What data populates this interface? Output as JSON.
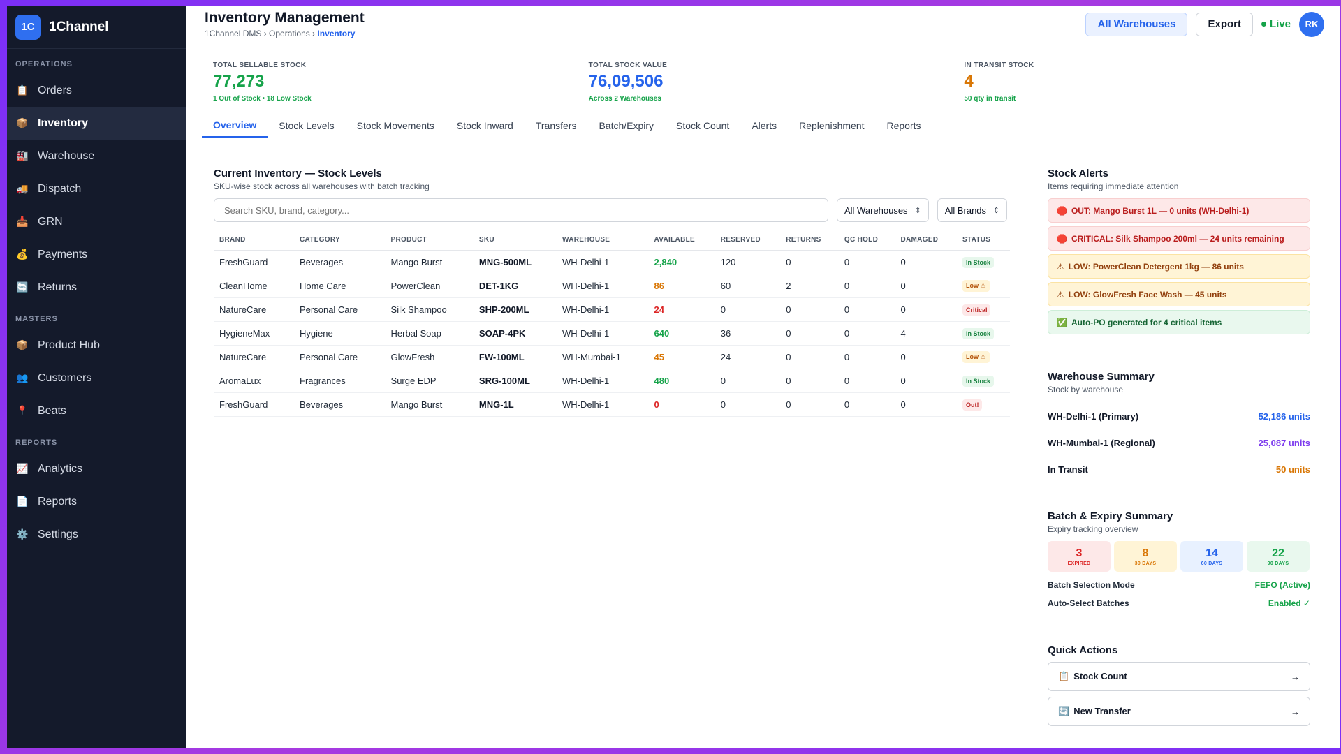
{
  "brand": {
    "logo": "1C",
    "name": "1Channel"
  },
  "sidebar": {
    "sections": [
      {
        "title": "OPERATIONS",
        "items": [
          {
            "label": "Orders",
            "icon": "📋"
          },
          {
            "label": "Inventory",
            "icon": "📦",
            "active": true
          },
          {
            "label": "Warehouse",
            "icon": "🏭"
          },
          {
            "label": "Dispatch",
            "icon": "🚚"
          },
          {
            "label": "GRN",
            "icon": "📥"
          },
          {
            "label": "Payments",
            "icon": "💰"
          },
          {
            "label": "Returns",
            "icon": "🔄"
          }
        ]
      },
      {
        "title": "MASTERS",
        "items": [
          {
            "label": "Product Hub",
            "icon": "📦"
          },
          {
            "label": "Customers",
            "icon": "👥"
          },
          {
            "label": "Beats",
            "icon": "📍"
          }
        ]
      },
      {
        "title": "REPORTS",
        "items": [
          {
            "label": "Analytics",
            "icon": "📈"
          },
          {
            "label": "Reports",
            "icon": "📄"
          },
          {
            "label": "Settings",
            "icon": "⚙️"
          }
        ]
      }
    ]
  },
  "header": {
    "title": "Inventory Management",
    "breadcrumb": [
      "1Channel DMS",
      "Operations",
      "Inventory"
    ],
    "buttons": {
      "warehouses": "All Warehouses",
      "export": "Export"
    },
    "live": "Live",
    "avatar": "RK"
  },
  "kpis": [
    {
      "label": "TOTAL SELLABLE STOCK",
      "value": "77,273",
      "sub": "1 Out of Stock • 18 Low Stock",
      "color": "#16a34a"
    },
    {
      "label": "TOTAL STOCK VALUE",
      "value": "76,09,506",
      "sub": "Across 2 Warehouses",
      "color": "#2563eb"
    },
    {
      "label": "IN TRANSIT STOCK",
      "value": "4",
      "sub": "50 qty in transit",
      "color": "#d97706"
    }
  ],
  "tabs": [
    "Overview",
    "Stock Levels",
    "Stock Movements",
    "Stock Inward",
    "Transfers",
    "Batch/Expiry",
    "Stock Count",
    "Alerts",
    "Replenishment",
    "Reports"
  ],
  "inventory": {
    "title": "Current Inventory — Stock Levels",
    "subtitle": "SKU-wise stock across all warehouses with batch tracking",
    "search_placeholder": "Search SKU, brand, category...",
    "filter_warehouse": "All Warehouses",
    "filter_brand": "All Brands",
    "columns": [
      "BRAND",
      "CATEGORY",
      "PRODUCT",
      "SKU",
      "WAREHOUSE",
      "AVAILABLE",
      "RESERVED",
      "RETURNS",
      "QC HOLD",
      "DAMAGED",
      "STATUS"
    ],
    "rows": [
      {
        "brand": "FreshGuard",
        "category": "Beverages",
        "product": "Mango Burst",
        "sku": "MNG-500ML",
        "warehouse": "WH-Delhi-1",
        "available": "2,840",
        "reserved": "120",
        "returns": "0",
        "qc": "0",
        "damaged": "0",
        "status": "In Stock",
        "kind": "instock",
        "avail_color": "#16a34a"
      },
      {
        "brand": "CleanHome",
        "category": "Home Care",
        "product": "PowerClean",
        "sku": "DET-1KG",
        "warehouse": "WH-Delhi-1",
        "available": "86",
        "reserved": "60",
        "returns": "2",
        "qc": "0",
        "damaged": "0",
        "status": "Low ⚠",
        "kind": "low",
        "avail_color": "#d97706"
      },
      {
        "brand": "NatureCare",
        "category": "Personal Care",
        "product": "Silk Shampoo",
        "sku": "SHP-200ML",
        "warehouse": "WH-Delhi-1",
        "available": "24",
        "reserved": "0",
        "returns": "0",
        "qc": "0",
        "damaged": "0",
        "status": "Critical",
        "kind": "critical",
        "avail_color": "#dc2626"
      },
      {
        "brand": "HygieneMax",
        "category": "Hygiene",
        "product": "Herbal Soap",
        "sku": "SOAP-4PK",
        "warehouse": "WH-Delhi-1",
        "available": "640",
        "reserved": "36",
        "returns": "0",
        "qc": "0",
        "damaged": "4",
        "status": "In Stock",
        "kind": "instock",
        "avail_color": "#16a34a"
      },
      {
        "brand": "NatureCare",
        "category": "Personal Care",
        "product": "GlowFresh",
        "sku": "FW-100ML",
        "warehouse": "WH-Mumbai-1",
        "available": "45",
        "reserved": "24",
        "returns": "0",
        "qc": "0",
        "damaged": "0",
        "status": "Low ⚠",
        "kind": "low",
        "avail_color": "#d97706"
      },
      {
        "brand": "AromaLux",
        "category": "Fragrances",
        "product": "Surge EDP",
        "sku": "SRG-100ML",
        "warehouse": "WH-Delhi-1",
        "available": "480",
        "reserved": "0",
        "returns": "0",
        "qc": "0",
        "damaged": "0",
        "status": "In Stock",
        "kind": "instock",
        "avail_color": "#16a34a"
      },
      {
        "brand": "FreshGuard",
        "category": "Beverages",
        "product": "Mango Burst",
        "sku": "MNG-1L",
        "warehouse": "WH-Delhi-1",
        "available": "0",
        "reserved": "0",
        "returns": "0",
        "qc": "0",
        "damaged": "0",
        "status": "Out!",
        "kind": "out",
        "avail_color": "#dc2626"
      }
    ]
  },
  "alerts": {
    "title": "Stock Alerts",
    "subtitle": "Items requiring immediate attention",
    "items": [
      {
        "icon": "🛑",
        "text": "OUT: Mango Burst 1L — 0 units (WH-Delhi-1)",
        "kind": "red"
      },
      {
        "icon": "🛑",
        "text": "CRITICAL: Silk Shampoo 200ml — 24 units remaining",
        "kind": "red"
      },
      {
        "icon": "⚠",
        "text": "LOW: PowerClean Detergent 1kg — 86 units",
        "kind": "yellow"
      },
      {
        "icon": "⚠",
        "text": "LOW: GlowFresh Face Wash — 45 units",
        "kind": "yellow"
      },
      {
        "icon": "✅",
        "text": "Auto-PO generated for 4 critical items",
        "kind": "green"
      }
    ]
  },
  "warehouse_summary": {
    "title": "Warehouse Summary",
    "subtitle": "Stock by warehouse",
    "rows": [
      {
        "name": "WH-Delhi-1 (Primary)",
        "value": "52,186 units",
        "color": "#2563eb"
      },
      {
        "name": "WH-Mumbai-1 (Regional)",
        "value": "25,087 units",
        "color": "#7c3aed"
      },
      {
        "name": "In Transit",
        "value": "50 units",
        "color": "#d97706"
      }
    ]
  },
  "batch": {
    "title": "Batch & Expiry Summary",
    "subtitle": "Expiry tracking overview",
    "boxes": [
      {
        "num": "3",
        "label": "EXPIRED",
        "bg": "#fde8e8",
        "color": "#dc2626"
      },
      {
        "num": "8",
        "label": "30 DAYS",
        "bg": "#fff4d6",
        "color": "#d97706"
      },
      {
        "num": "14",
        "label": "60 DAYS",
        "bg": "#e8f1ff",
        "color": "#2563eb"
      },
      {
        "num": "22",
        "label": "90 DAYS",
        "bg": "#e9f8ee",
        "color": "#16a34a"
      }
    ],
    "mode_label": "Batch Selection Mode",
    "mode_value": "FEFO (Active)",
    "auto_label": "Auto-Select Batches",
    "auto_value": "Enabled ✓"
  },
  "quick_actions": {
    "title": "Quick Actions",
    "items": [
      {
        "icon": "📋",
        "label": "Stock Count"
      },
      {
        "icon": "🔄",
        "label": "New Transfer"
      }
    ]
  }
}
